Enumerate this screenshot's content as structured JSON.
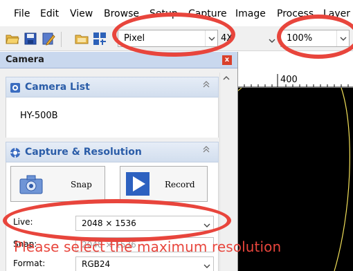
{
  "menu": [
    "File",
    "Edit",
    "View",
    "Browse",
    "Setup",
    "Capture",
    "Image",
    "Process",
    "Layer"
  ],
  "toolbar": {
    "unit_combo": "Pixel",
    "zoom_prefix": "4X",
    "zoom_combo": "100%",
    "icons": [
      "open-folder-icon",
      "save-icon",
      "edit-icon",
      "folder-icon",
      "grid-icon"
    ]
  },
  "panel": {
    "title": "Camera",
    "close": "x",
    "camera_list": {
      "title": "Camera List",
      "device": "HY-500B"
    },
    "capture": {
      "title": "Capture & Resolution",
      "snap_label": "Snap",
      "record_label": "Record",
      "live_label": "Live:",
      "live_value": "2048 × 1536",
      "snap_row_label": "Snap:",
      "snap_row_value": "2048 × 1536",
      "format_label": "Format:",
      "format_value": "RGB24"
    }
  },
  "ruler": {
    "label": "400"
  },
  "annotation": {
    "note": "Please select the maximum resolution",
    "color": "#e8453c"
  }
}
